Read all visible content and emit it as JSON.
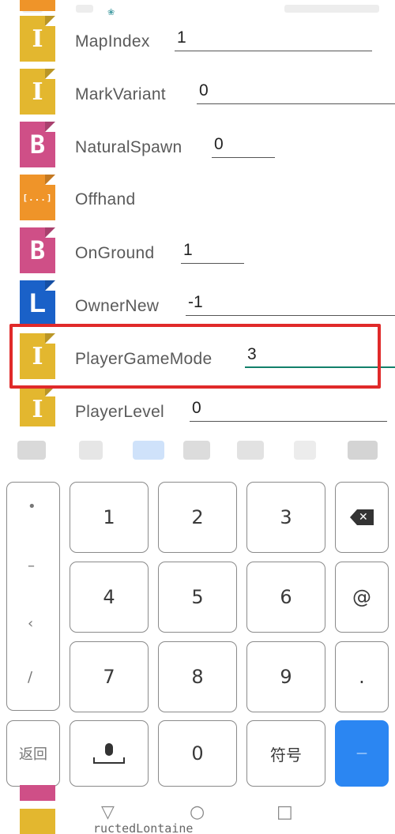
{
  "colors": {
    "int_tag": "#e3b72f",
    "byte_tag": "#cf4f87",
    "long_tag": "#1a61c8",
    "list_tag": "#ef9429",
    "highlight": "#e02a2a",
    "enter_key": "#2b86f2",
    "active_underline": "#12806a"
  },
  "tags": [
    {
      "type": "int",
      "icon": "int-tag-icon",
      "glyph": "I",
      "name": "MapIndex",
      "value": "1"
    },
    {
      "type": "int",
      "icon": "int-tag-icon",
      "glyph": "I",
      "name": "MarkVariant",
      "value": "0"
    },
    {
      "type": "byte",
      "icon": "byte-tag-icon",
      "glyph": "B",
      "name": "NaturalSpawn",
      "value": "0"
    },
    {
      "type": "list",
      "icon": "list-tag-icon",
      "glyph": "[...]",
      "name": "Offhand",
      "value": null
    },
    {
      "type": "byte",
      "icon": "byte-tag-icon",
      "glyph": "B",
      "name": "OnGround",
      "value": "1"
    },
    {
      "type": "long",
      "icon": "long-tag-icon",
      "glyph": "L",
      "name": "OwnerNew",
      "value": "-1"
    },
    {
      "type": "int",
      "icon": "int-tag-icon",
      "glyph": "I",
      "name": "PlayerGameMode",
      "value": "3"
    },
    {
      "type": "int",
      "icon": "int-tag-icon",
      "glyph": "I",
      "name": "PlayerLevel",
      "value": "0"
    }
  ],
  "keyboard": {
    "keys": {
      "k1": "1",
      "k2": "2",
      "k3": "3",
      "k4": "4",
      "k5": "5",
      "k6": "6",
      "k7": "7",
      "k8": "8",
      "k9": "9",
      "k0": "0",
      "at": "@",
      "dot": ".",
      "symbols": "符号",
      "back_label": "返回",
      "side_slash": "/"
    },
    "icons": {
      "backspace": "backspace-icon",
      "mic": "microphone-icon",
      "enter": "enter-icon"
    }
  },
  "navbar": {
    "icons": [
      "back-nav-icon",
      "home-nav-icon",
      "recents-nav-icon"
    ]
  },
  "bottom_text": "ructedLontaine"
}
